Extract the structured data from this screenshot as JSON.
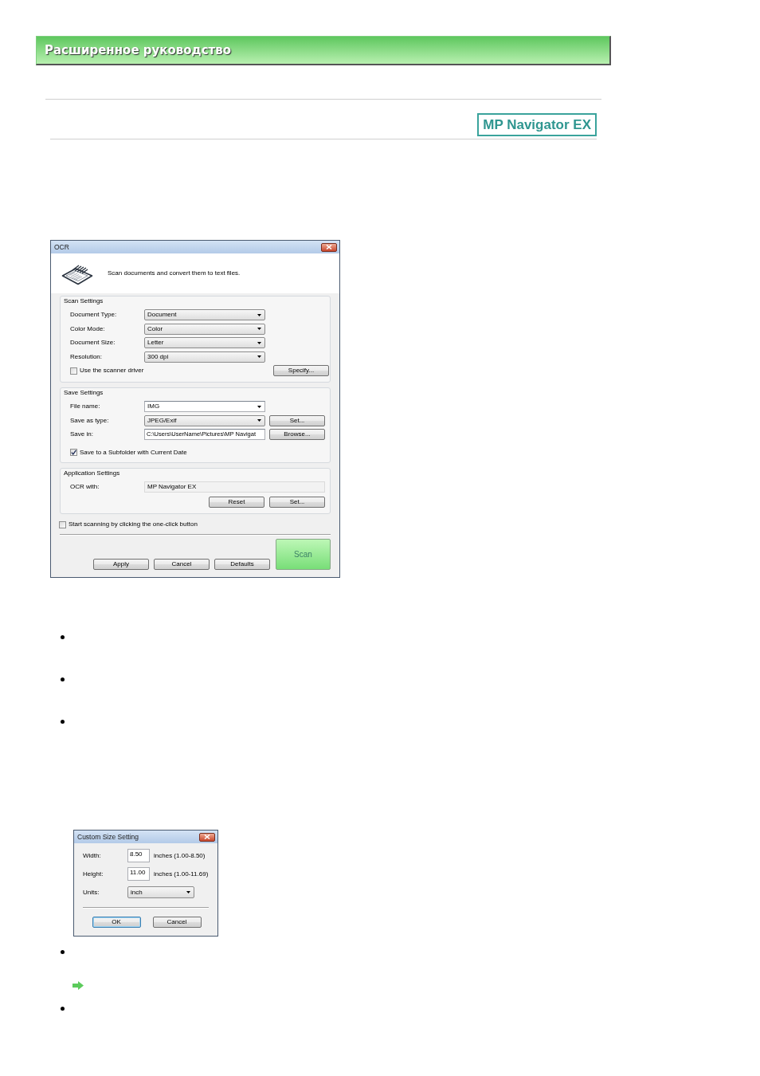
{
  "header": {
    "title": "Расширенное руководство"
  },
  "product_logo": {
    "label": "MP Navigator EX"
  },
  "content": [
    {
      "kind": "ocr_dialog",
      "title": "OCR",
      "description": "Scan documents and convert them to text files.",
      "groups": [
        {
          "title": "Scan Settings",
          "rows": [
            {
              "kind": "dropdown",
              "label": "Document Type:",
              "value": "Document"
            },
            {
              "kind": "dropdown",
              "label": "Color Mode:",
              "value": "Color"
            },
            {
              "kind": "dropdown",
              "label": "Document Size:",
              "value": "Letter"
            },
            {
              "kind": "dropdown",
              "label": "Resolution:",
              "value": "300 dpi"
            },
            {
              "kind": "checkbox",
              "label": "Use the scanner driver",
              "checked": false,
              "button": "Specify..."
            }
          ]
        },
        {
          "title": "Save Settings",
          "rows": [
            {
              "kind": "combo",
              "label": "File name:",
              "value": "IMG"
            },
            {
              "kind": "dropdown",
              "label": "Save as type:",
              "value": "JPEG/Exif",
              "button": "Set..."
            },
            {
              "kind": "text",
              "label": "Save in:",
              "value": "C:\\Users\\UserName\\Pictures\\MP Navigat",
              "button": "Browse..."
            },
            {
              "kind": "checkbox",
              "label": "Save to a Subfolder with Current Date",
              "checked": true
            }
          ]
        },
        {
          "title": "Application Settings",
          "rows": [
            {
              "kind": "readonly",
              "label": "OCR with:",
              "value": "MP Navigator EX"
            },
            {
              "kind": "buttons",
              "buttons": [
                "Reset",
                "Set..."
              ]
            }
          ]
        }
      ],
      "one_click": {
        "label": "Start scanning by clicking the one-click button",
        "checked": false
      },
      "buttons": [
        "Apply",
        "Cancel",
        "Defaults"
      ],
      "scan_button": "Scan"
    },
    {
      "kind": "bullet"
    },
    {
      "kind": "bullet"
    },
    {
      "kind": "bullet"
    },
    {
      "kind": "size_dialog",
      "title": "Custom Size Setting",
      "fields": [
        {
          "label": "Width:",
          "value": "8.50",
          "range": "inches (1.00-8.50)"
        },
        {
          "label": "Height:",
          "value": "11.00",
          "range": "inches (1.00-11.69)"
        }
      ],
      "units": {
        "label": "Units:",
        "value": "inch"
      },
      "buttons": [
        {
          "label": "OK",
          "default": true
        },
        {
          "label": "Cancel",
          "default": false
        }
      ]
    },
    {
      "kind": "bullet"
    },
    {
      "kind": "link_arrow"
    },
    {
      "kind": "bullet"
    }
  ]
}
